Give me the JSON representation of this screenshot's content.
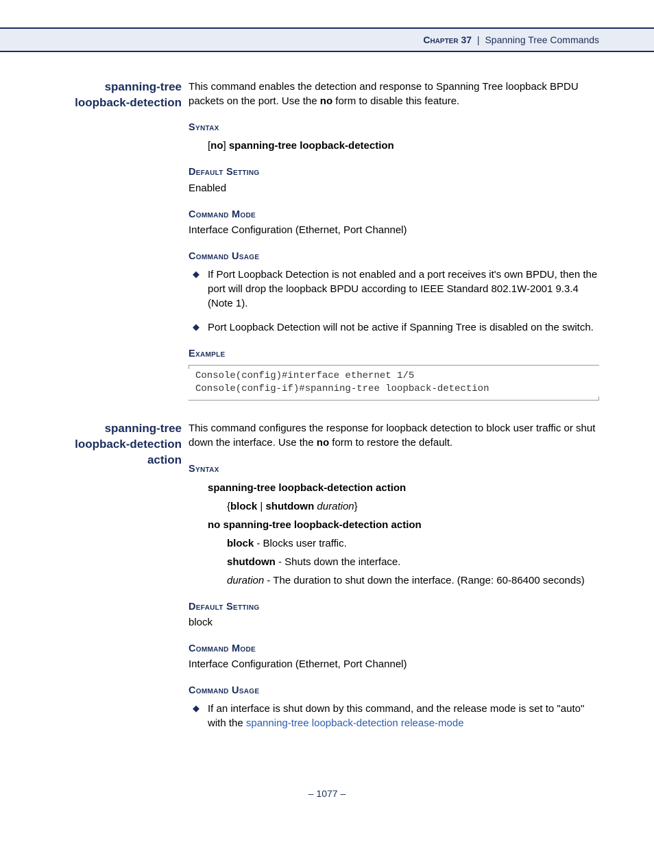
{
  "header": {
    "chapter": "Chapter 37",
    "separator": "|",
    "title": "Spanning Tree Commands"
  },
  "entries": [
    {
      "sideLabel": "spanning-tree loopback-detection",
      "descPrefix": "This command enables the detection and response to Spanning Tree loopback BPDU packets on the port. Use the ",
      "descBold": "no",
      "descSuffix": " form to disable this feature.",
      "syntaxHead": "Syntax",
      "syntax": {
        "open": "[",
        "noWord": "no",
        "close": "] ",
        "cmd": "spanning-tree loopback-detection"
      },
      "defaultHead": "Default Setting",
      "defaultVal": "Enabled",
      "modeHead": "Command Mode",
      "modeVal": "Interface Configuration (Ethernet, Port Channel)",
      "usageHead": "Command Usage",
      "usage": [
        "If Port Loopback Detection is not enabled and a port receives it's own BPDU, then the port will drop the loopback BPDU according to IEEE Standard 802.1W-2001 9.3.4 (Note 1).",
        "Port Loopback Detection will not be active if Spanning Tree is disabled on the switch."
      ],
      "exampleHead": "Example",
      "exampleText": "Console(config)#interface ethernet 1/5\nConsole(config-if)#spanning-tree loopback-detection"
    },
    {
      "sideLabel": "spanning-tree loopback-detection action",
      "descPrefix": "This command configures the response for loopback detection to block user traffic or shut down the interface. Use the ",
      "descBold": "no",
      "descSuffix": " form to restore the default.",
      "syntaxHead": "Syntax",
      "syntax2": {
        "line1": "spanning-tree loopback-detection action",
        "line2open": "{",
        "line2a": "block",
        "line2sep": " | ",
        "line2b": "shutdown",
        "line2it": " duration",
        "line2close": "}",
        "noLine": "no spanning-tree loopback-detection action",
        "params": [
          {
            "term": "block",
            "desc": " - Blocks user traffic."
          },
          {
            "term": "shutdown",
            "desc": " - Shuts down the interface."
          },
          {
            "termItalic": "duration",
            "desc": " - The duration to shut down the interface. (Range: 60-86400 seconds)"
          }
        ]
      },
      "defaultHead": "Default Setting",
      "defaultVal": "block",
      "modeHead": "Command Mode",
      "modeVal": "Interface Configuration (Ethernet, Port Channel)",
      "usageHead": "Command Usage",
      "usage2": {
        "prefix": "If an interface is shut down by this command, and the release mode is set to \"auto\" with the ",
        "link": "spanning-tree loopback-detection release-mode"
      }
    }
  ],
  "footer": {
    "dashL": "–  ",
    "page": "1077",
    "dashR": "  –"
  }
}
